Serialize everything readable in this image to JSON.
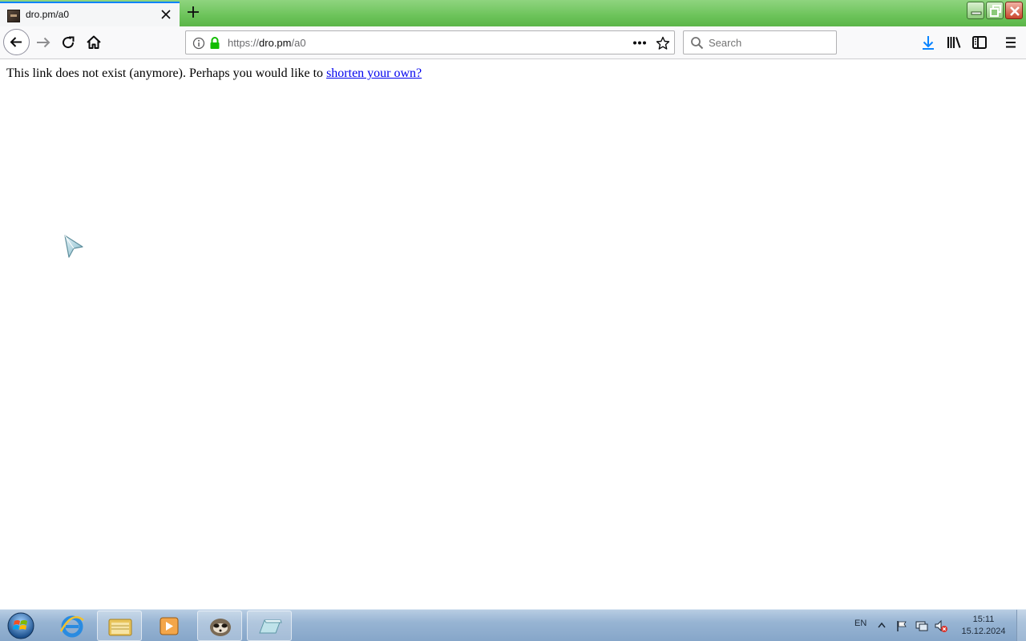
{
  "browser": {
    "tab": {
      "title": "dro.pm/a0"
    },
    "url": {
      "scheme": "https://",
      "host": "dro.pm",
      "path": "/a0"
    },
    "search": {
      "placeholder": "Search"
    }
  },
  "page": {
    "message": "This link does not exist (anymore). Perhaps you would like to ",
    "link_text": "shorten your own?"
  },
  "taskbar": {
    "language": "EN",
    "time": "15:11",
    "date": "15.12.2024",
    "items": [
      "start-orb",
      "internet-explorer",
      "file-explorer",
      "media-player",
      "app-raccoon",
      "app-notes"
    ]
  },
  "colors": {
    "titlebar": "#6cc35a",
    "tab_accent": "#0a84ff",
    "link": "#0000ee",
    "secure_lock": "#12bc00",
    "download_icon": "#0a84ff"
  }
}
